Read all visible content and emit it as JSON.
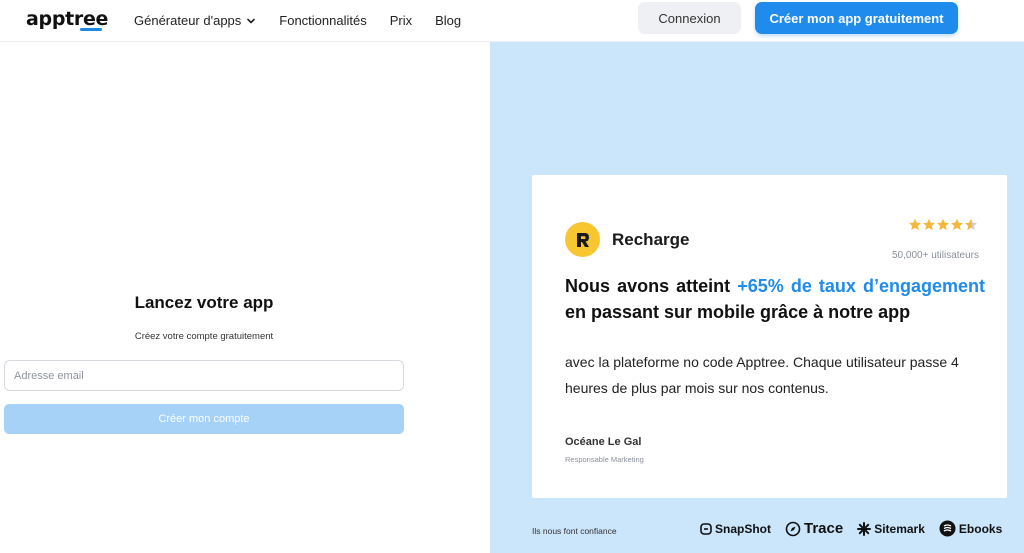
{
  "header": {
    "logo": "apptree",
    "nav": [
      {
        "label": "Générateur d'apps",
        "has_dropdown": true
      },
      {
        "label": "Fonctionnalités"
      },
      {
        "label": "Prix"
      },
      {
        "label": "Blog"
      }
    ],
    "login_label": "Connexion",
    "cta_label": "Créer mon app gratuitement"
  },
  "signup": {
    "title": "Lancez votre app",
    "subtitle": "Créez votre compte gratuitement",
    "email_placeholder": "Adresse email",
    "email_value": "",
    "submit_label": "Créer mon compte"
  },
  "testimonial": {
    "brand": "Recharge",
    "rating": 4.5,
    "users": "50,000+ utilisateurs",
    "quote_before": "Nous avons atteint ",
    "quote_highlight": "+65% de taux d’engagement",
    "quote_after": " en passant sur mobile grâce à notre app",
    "quote_rest": "avec la plateforme no code Apptree. Chaque utilisateur passe 4 heures de plus par mois sur nos contenus.",
    "author": "Océane Le Gal",
    "role": "Responsable Marketing"
  },
  "trust": {
    "label": "Ils nous font confiance",
    "partners": [
      "SnapShot",
      "Trace",
      "Sitemark",
      "Ebooks"
    ]
  },
  "colors": {
    "accent": "#1f8bec",
    "panel": "#cbe5fb",
    "star": "#f4b73a",
    "brand_logo": "#f7c631"
  }
}
